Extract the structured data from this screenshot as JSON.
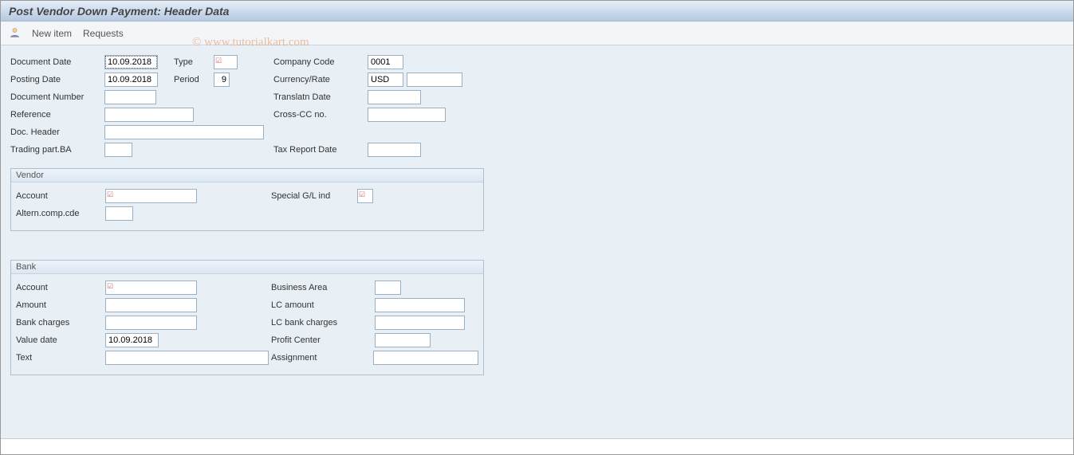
{
  "title": "Post Vendor Down Payment: Header Data",
  "watermark": "© www.tutorialkart.com",
  "toolbar": {
    "new_item": "New item",
    "requests": "Requests"
  },
  "header": {
    "document_date_label": "Document Date",
    "document_date": "10.09.2018",
    "type_label": "Type",
    "type": "",
    "posting_date_label": "Posting Date",
    "posting_date": "10.09.2018",
    "period_label": "Period",
    "period": "9",
    "document_number_label": "Document Number",
    "document_number": "",
    "reference_label": "Reference",
    "reference": "",
    "doc_header_label": "Doc. Header",
    "doc_header": "",
    "trading_part_label": "Trading part.BA",
    "trading_part": "",
    "company_code_label": "Company Code",
    "company_code": "0001",
    "currency_label": "Currency/Rate",
    "currency": "USD",
    "rate": "",
    "translatn_date_label": "Translatn Date",
    "translatn_date": "",
    "cross_cc_label": "Cross-CC no.",
    "cross_cc": "",
    "tax_report_label": "Tax Report Date",
    "tax_report": ""
  },
  "vendor": {
    "title": "Vendor",
    "account_label": "Account",
    "account": "",
    "altern_label": "Altern.comp.cde",
    "altern": "",
    "glind_label": "Special G/L ind",
    "glind": ""
  },
  "bank": {
    "title": "Bank",
    "account_label": "Account",
    "account": "",
    "amount_label": "Amount",
    "amount": "",
    "charges_label": "Bank charges",
    "charges": "",
    "value_date_label": "Value date",
    "value_date": "10.09.2018",
    "text_label": "Text",
    "text": "",
    "ba_label": "Business Area",
    "ba": "",
    "lcamt_label": "LC amount",
    "lcamt": "",
    "lccharge_label": "LC bank charges",
    "lccharge": "",
    "pc_label": "Profit Center",
    "pc": "",
    "assign_label": "Assignment",
    "assign": ""
  }
}
